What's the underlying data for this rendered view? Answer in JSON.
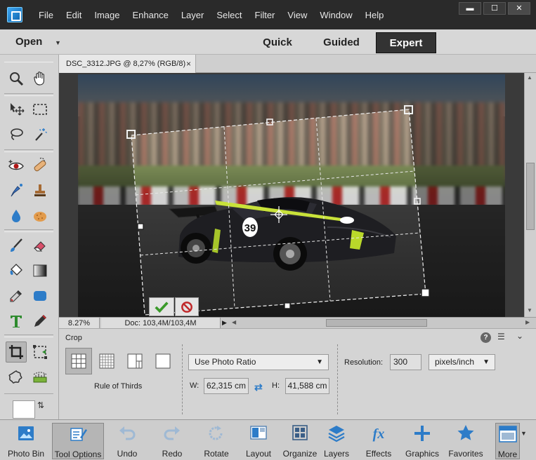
{
  "menubar": {
    "items": [
      "File",
      "Edit",
      "Image",
      "Enhance",
      "Layer",
      "Select",
      "Filter",
      "View",
      "Window",
      "Help"
    ],
    "window_controls": [
      "▬",
      "☐",
      "✕"
    ]
  },
  "modebar": {
    "open_label": "Open",
    "tabs": [
      {
        "label": "Quick"
      },
      {
        "label": "Guided"
      },
      {
        "label": "Expert",
        "selected": true
      }
    ]
  },
  "document": {
    "tab_title": "DSC_3312.JPG @ 8,27% (RGB/8)",
    "close_glyph": "×"
  },
  "status": {
    "zoom": "8.27%",
    "doc_size": "Doc: 103,4M/103,4M"
  },
  "tool_options": {
    "title": "Crop",
    "overlay_label": "Rule of Thirds",
    "ratio_value": "Use Photo Ratio",
    "width_label": "W:",
    "width_value": "62,315 cm",
    "height_label": "H:",
    "height_value": "41,588 cm",
    "resolution_label": "Resolution:",
    "resolution_value": "300",
    "units_value": "pixels/inch",
    "help_glyph": "?"
  },
  "car": {
    "number": "39"
  },
  "taskbar": {
    "items": [
      {
        "label": "Photo Bin",
        "icon": "photo-bin-icon"
      },
      {
        "label": "Tool Options",
        "icon": "tool-options-icon",
        "active": true
      },
      {
        "label": "Undo",
        "icon": "undo-icon"
      },
      {
        "label": "Redo",
        "icon": "redo-icon"
      },
      {
        "label": "Rotate",
        "icon": "rotate-icon"
      },
      {
        "label": "Layout",
        "icon": "layout-icon"
      },
      {
        "label": "Organize",
        "icon": "organize-icon"
      },
      {
        "label": "Layers",
        "icon": "layers-icon"
      },
      {
        "label": "Effects",
        "icon": "effects-icon"
      },
      {
        "label": "Graphics",
        "icon": "graphics-icon"
      },
      {
        "label": "Favorites",
        "icon": "favorites-icon"
      },
      {
        "label": "More",
        "icon": "more-icon"
      }
    ]
  },
  "colors": {
    "expert_tab_bg": "#333333",
    "accent_blue": "#2d7cc8",
    "commit_green": "#3a9a2a",
    "cancel_red": "#c0282a"
  }
}
